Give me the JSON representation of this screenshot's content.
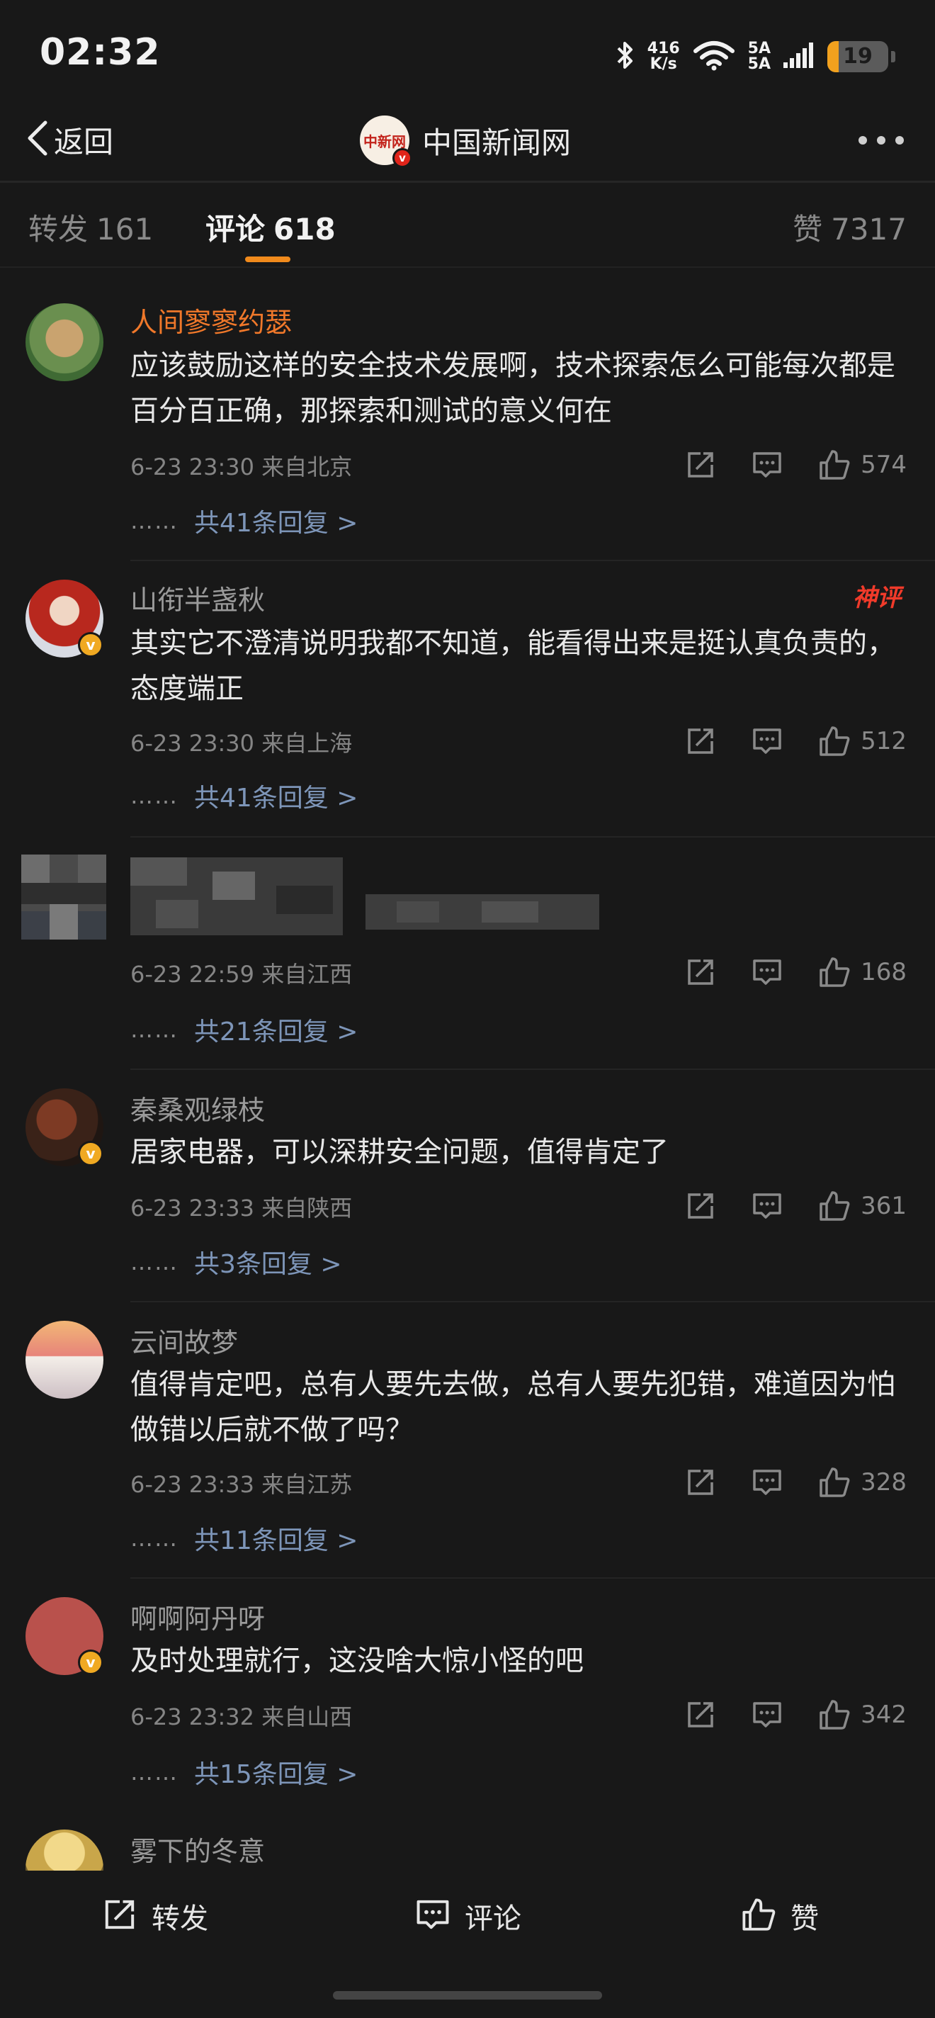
{
  "status": {
    "time": "02:32",
    "net_speed_top": "416",
    "net_speed_bottom": "K/s",
    "sim_top": "5A",
    "sim_bottom": "5A",
    "battery": "19",
    "battery_level": 0.19
  },
  "header": {
    "back_label": "返回",
    "account_name": "中国新闻网",
    "logo_text": "中新网"
  },
  "tabs": {
    "repost": {
      "label": "转发",
      "count": "161"
    },
    "comments": {
      "label": "评论",
      "count": "618"
    },
    "likes": {
      "label": "赞",
      "count": "7317"
    }
  },
  "comments": [
    {
      "user": "人间寥寥约瑟",
      "text": "应该鼓励这样的安全技术发展啊，技术探索怎么可能每次都是百分百正确，那探索和测试的意义何在",
      "time": "6-23 23:30 来自北京",
      "likes": "574",
      "replies": "共41条回复 >"
    },
    {
      "user": "山衔半盏秋",
      "badge": "神评",
      "text": "其实它不澄清说明我都不知道，能看得出来是挺认真负责的，态度端正",
      "time": "6-23 23:30 来自上海",
      "likes": "512",
      "replies": "共41条回复 >"
    },
    {
      "user": "",
      "text": "",
      "time": "6-23 22:59 来自江西",
      "likes": "168",
      "replies": "共21条回复 >"
    },
    {
      "user": "秦桑观绿枝",
      "text": "居家电器，可以深耕安全问题，值得肯定了",
      "time": "6-23 23:33 来自陕西",
      "likes": "361",
      "replies": "共3条回复 >"
    },
    {
      "user": "云间故梦",
      "text": "值得肯定吧，总有人要先去做，总有人要先犯错，难道因为怕做错以后就不做了吗？",
      "time": "6-23 23:33 来自江苏",
      "likes": "328",
      "replies": "共11条回复 >"
    },
    {
      "user": "啊啊阿丹呀",
      "text": "及时处理就行，这没啥大惊小怪的吧",
      "time": "6-23 23:32 来自山西",
      "likes": "342",
      "replies": "共15条回复 >"
    },
    {
      "user": "雾下的冬意"
    }
  ],
  "ellipsis": "……",
  "bottom_bar": {
    "repost": "转发",
    "comment": "评论",
    "like": "赞"
  },
  "icons": {
    "back": "chevron-left-icon",
    "more": "more-dots-icon",
    "share": "share-icon",
    "comment": "comment-icon",
    "like": "thumbs-up-icon",
    "bluetooth": "bluetooth-icon",
    "wifi": "wifi-icon",
    "signal": "signal-icon",
    "battery": "battery-icon"
  },
  "colors": {
    "background": "#181818",
    "accent": "#f08a1c",
    "highlight_name": "#f0782a",
    "reply_link": "#7d95b8",
    "hot_badge": "#f03a2a"
  }
}
